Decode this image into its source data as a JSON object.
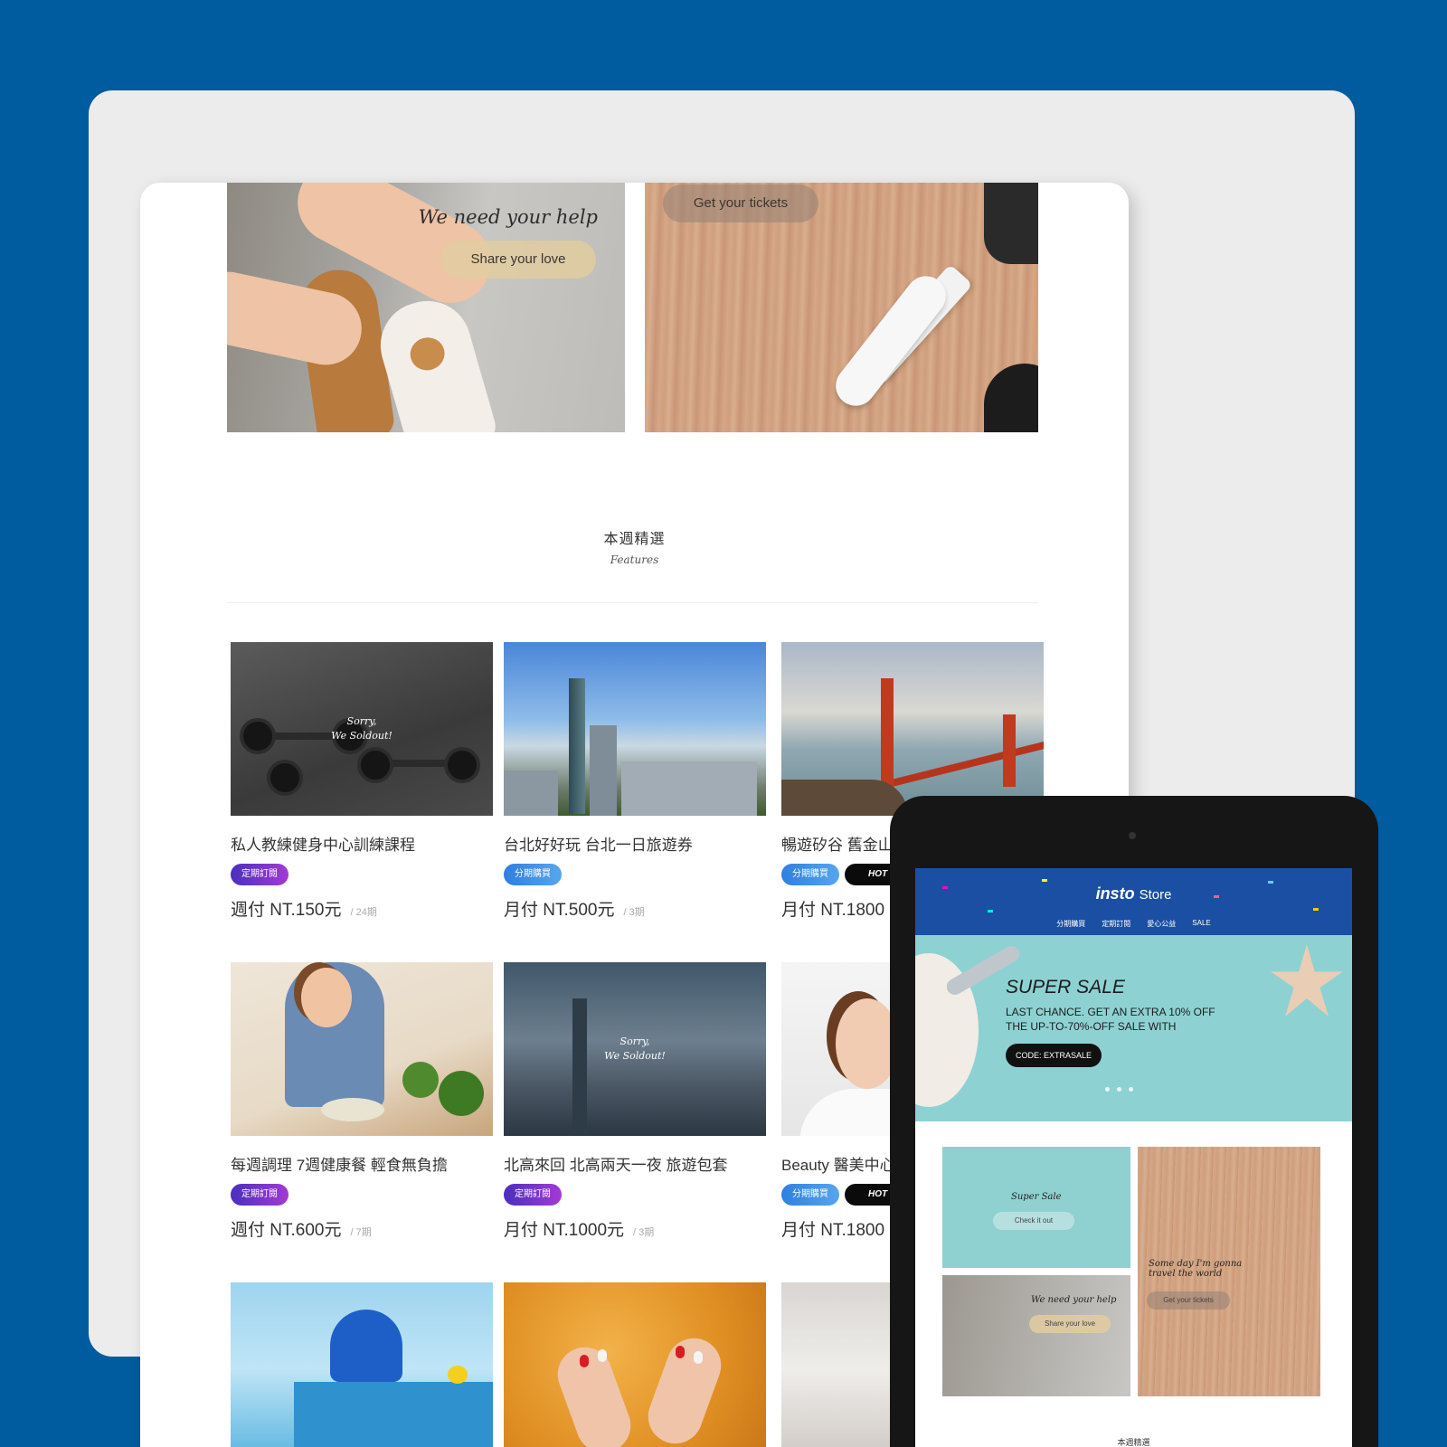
{
  "banners": {
    "help": {
      "title": "We need your help",
      "button": "Share your love"
    },
    "tickets": {
      "button": "Get your  tickets"
    }
  },
  "features": {
    "title": "本週精選",
    "subtitle": "Features"
  },
  "cards": [
    {
      "name": "私人教練健身中心訓練課程",
      "tags": [
        "定期訂閱"
      ],
      "price": "週付 NT.150元",
      "period": "/ 24期",
      "soldout": "Sorry,\nWe Soldout!"
    },
    {
      "name": "台北好好玩 台北一日旅遊券",
      "tags": [
        "分期購買"
      ],
      "price": "月付 NT.500元",
      "period": "/ 3期"
    },
    {
      "name": "暢遊矽谷 舊金山",
      "tags": [
        "分期購買",
        "HOT"
      ],
      "price": "月付 NT.1800"
    },
    {
      "name": "每週調理 7週健康餐 輕食無負擔",
      "tags": [
        "定期訂閱"
      ],
      "price": "週付 NT.600元",
      "period": "/ 7期"
    },
    {
      "name": "北高來回 北高兩天一夜 旅遊包套",
      "tags": [
        "定期訂閱"
      ],
      "price": "月付 NT.1000元",
      "period": "/ 3期",
      "soldout": "Sorry,\nWe Soldout!"
    },
    {
      "name": "Beauty 醫美中心",
      "tags": [
        "分期購買",
        "HOT"
      ],
      "price": "月付 NT.1800"
    }
  ],
  "tablet": {
    "brand": "insto",
    "brand_suffix": "Store",
    "nav": [
      "分期購買",
      "定期訂閱",
      "愛心公益",
      "SALE"
    ],
    "hero": {
      "title": "SUPER SALE",
      "line1": "LAST CHANCE. GET AN EXTRA 10% OFF",
      "line2": "THE UP-TO-70%-OFF SALE WITH",
      "code": "CODE: EXTRASALE"
    },
    "tiles": {
      "super": {
        "title": "Super Sale",
        "button": "Check it out"
      },
      "help": {
        "title": "We need your help",
        "button": "Share your love"
      },
      "trip": {
        "title": "Some day I'm gonna\ntravel the world",
        "button": "Get your  tickets"
      }
    },
    "footer": "本週精選"
  },
  "colors": {
    "background": "#005b9f",
    "tablet_header": "#1b4fa3",
    "hot_tag": "#0b0b0b"
  }
}
